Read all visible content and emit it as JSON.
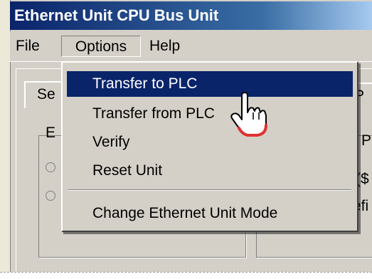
{
  "window": {
    "title": "Ethernet Unit CPU Bus Unit"
  },
  "menubar": {
    "file": "File",
    "options": "Options",
    "help": "Help"
  },
  "background": {
    "tab_partial": "Se",
    "tab2_partial": "P",
    "frag_e": "E",
    "frag_p": "P",
    "frag_s": "($",
    "frag_fi": "efi"
  },
  "options_menu": {
    "items": [
      {
        "label": "Transfer to PLC",
        "selected": true
      },
      {
        "label": "Transfer from PLC",
        "selected": false
      },
      {
        "label": "Verify",
        "selected": false
      },
      {
        "label": "Reset Unit",
        "selected": false
      },
      {
        "label": "Change Ethernet Unit Mode",
        "selected": false
      }
    ]
  },
  "colors": {
    "title_bar": "#0a246a",
    "highlight": "#0a246a",
    "face": "#d4d0c8",
    "cursor_fill": "#ffffff",
    "cursor_accent": "#e03030"
  },
  "cursor": {
    "icon": "hand-pointer-icon"
  }
}
